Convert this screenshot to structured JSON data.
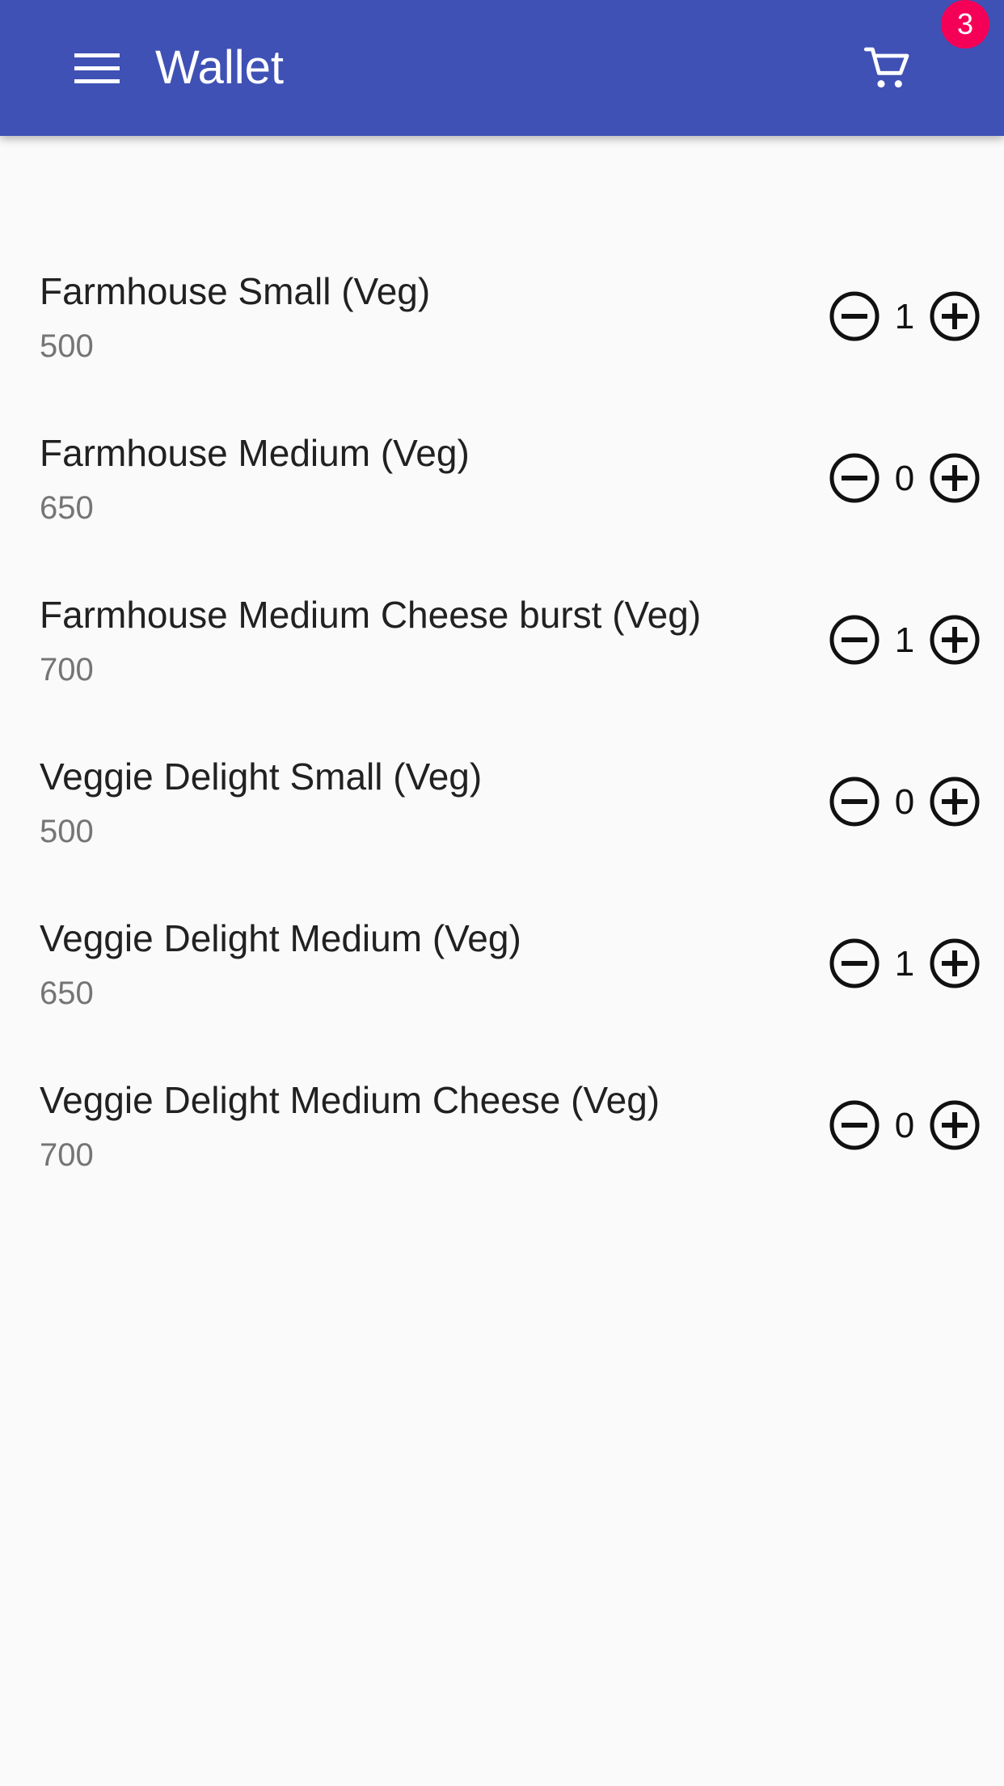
{
  "header": {
    "title": "Wallet",
    "cart_count": "3",
    "menu_icon": "menu-icon",
    "cart_icon": "cart-icon"
  },
  "colors": {
    "appbar": "#3f51b5",
    "badge": "#f50057",
    "background": "#fafafa"
  },
  "items": [
    {
      "name": "Farmhouse Small (Veg)",
      "price": "500",
      "qty": "1"
    },
    {
      "name": "Farmhouse Medium (Veg)",
      "price": "650",
      "qty": "0"
    },
    {
      "name": "Farmhouse Medium Cheese burst (Veg)",
      "price": "700",
      "qty": "1"
    },
    {
      "name": "Veggie Delight Small (Veg)",
      "price": "500",
      "qty": "0"
    },
    {
      "name": "Veggie Delight Medium (Veg)",
      "price": "650",
      "qty": "1"
    },
    {
      "name": "Veggie Delight Medium Cheese (Veg)",
      "price": "700",
      "qty": "0"
    }
  ]
}
